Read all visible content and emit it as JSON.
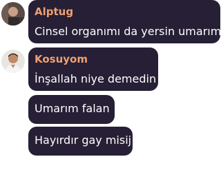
{
  "colors": {
    "bubble_bg": "#261f35",
    "name_color": "#f0a072",
    "text_color": "#ffffff"
  },
  "messages": [
    {
      "avatar_icon": "user-avatar-photo",
      "sender": "Alptug",
      "text": "Cinsel organımı da yersin umarım"
    },
    {
      "avatar_icon": "user-avatar-photo",
      "sender": "Kosuyom",
      "text": "İnşallah niye demedin"
    },
    {
      "text": "Umarım falan"
    },
    {
      "text": "Hayırdır gay misij"
    }
  ]
}
